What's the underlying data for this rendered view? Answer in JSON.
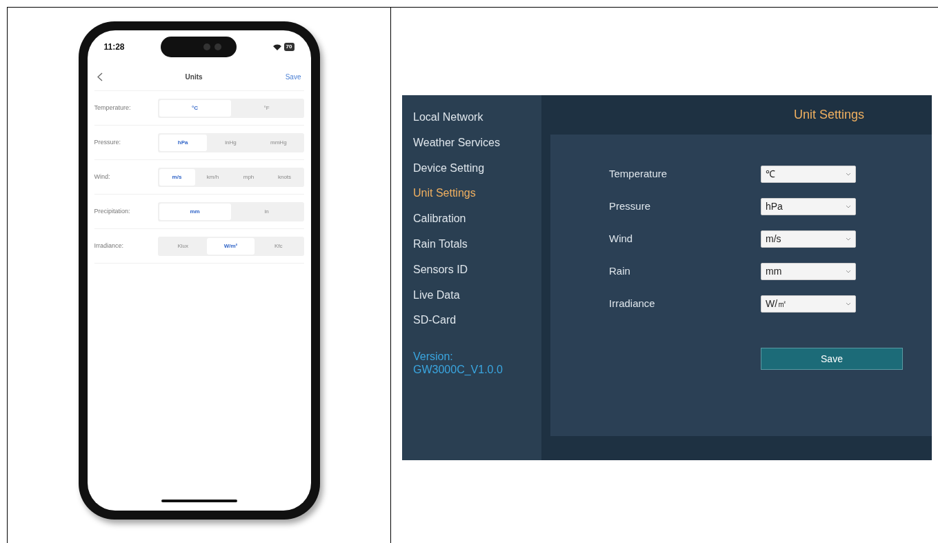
{
  "phone": {
    "status_bar": {
      "time": "11:28",
      "battery": "70"
    },
    "nav": {
      "title": "Units",
      "action": "Save"
    },
    "rows": [
      {
        "label": "Temperature:",
        "options": [
          {
            "label": "°C",
            "selected": true
          },
          {
            "label": "°F",
            "selected": false
          }
        ]
      },
      {
        "label": "Pressure:",
        "options": [
          {
            "label": "hPa",
            "selected": true
          },
          {
            "label": "inHg",
            "selected": false
          },
          {
            "label": "mmHg",
            "selected": false
          }
        ]
      },
      {
        "label": "Wind:",
        "options": [
          {
            "label": "m/s",
            "selected": true
          },
          {
            "label": "km/h",
            "selected": false
          },
          {
            "label": "mph",
            "selected": false
          },
          {
            "label": "knots",
            "selected": false
          }
        ]
      },
      {
        "label": "Precipitation:",
        "options": [
          {
            "label": "mm",
            "selected": true
          },
          {
            "label": "in",
            "selected": false
          }
        ]
      },
      {
        "label": "Irradiance:",
        "options": [
          {
            "label": "Klux",
            "selected": false
          },
          {
            "label": "W/m²",
            "selected": true
          },
          {
            "label": "Kfc",
            "selected": false
          }
        ]
      }
    ]
  },
  "web": {
    "sidebar": {
      "items": [
        {
          "label": "Local Network",
          "selected": false
        },
        {
          "label": "Weather Services",
          "selected": false
        },
        {
          "label": "Device Setting",
          "selected": false
        },
        {
          "label": "Unit Settings",
          "selected": true
        },
        {
          "label": "Calibration",
          "selected": false
        },
        {
          "label": "Rain Totals",
          "selected": false
        },
        {
          "label": "Sensors ID",
          "selected": false
        },
        {
          "label": "Live Data",
          "selected": false
        },
        {
          "label": "SD-Card",
          "selected": false
        }
      ],
      "version_label": "Version:",
      "version": "GW3000C_V1.0.0"
    },
    "title": "Unit Settings",
    "fields": [
      {
        "label": "Temperature",
        "value": "℃"
      },
      {
        "label": "Pressure",
        "value": "hPa"
      },
      {
        "label": "Wind",
        "value": "m/s"
      },
      {
        "label": "Rain",
        "value": "mm"
      },
      {
        "label": "Irradiance",
        "value": "W/㎡"
      }
    ],
    "save_button": "Save"
  }
}
